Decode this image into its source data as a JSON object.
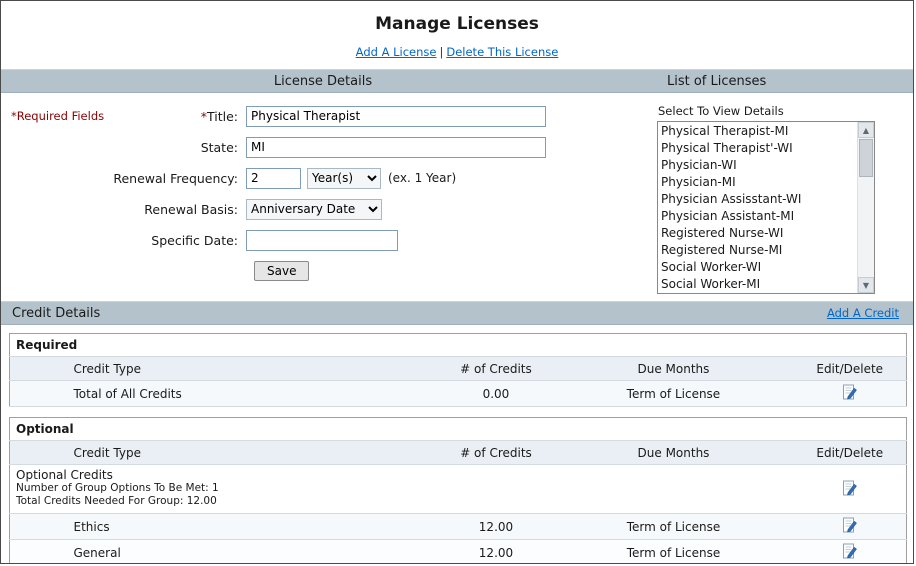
{
  "page": {
    "title": "Manage Licenses"
  },
  "top_links": {
    "add_license": "Add A License",
    "separator": "|",
    "delete_license": "Delete This License"
  },
  "colors": {
    "header_bar": "#b4c2cc",
    "link": "#0066cc",
    "required_red": "#8b0000",
    "table_header_row": "#e9eff4"
  },
  "license_details": {
    "header": "License Details",
    "required_note": "*Required Fields",
    "fields": {
      "title": {
        "star": "*",
        "label": "Title:",
        "value": "Physical Therapist"
      },
      "state": {
        "label": "State:",
        "value": "MI"
      },
      "renewal_frequency": {
        "label": "Renewal Frequency:",
        "value": "2",
        "unit": "Year(s)",
        "hint": "(ex. 1 Year)"
      },
      "renewal_basis": {
        "label": "Renewal Basis:",
        "value": "Anniversary Date"
      },
      "specific_date": {
        "label": "Specific Date:",
        "value": ""
      }
    },
    "save_label": "Save"
  },
  "list_of_licenses": {
    "header": "List of Licenses",
    "select_hint": "Select To View Details",
    "items": [
      "Physical Therapist-MI",
      "Physical Therapist'-WI",
      "Physician-WI",
      "Physician-MI",
      "Physician Assisstant-WI",
      "Physician Assistant-MI",
      "Registered Nurse-WI",
      "Registered Nurse-MI",
      "Social Worker-WI",
      "Social Worker-MI"
    ]
  },
  "credit_details": {
    "header": "Credit Details",
    "add_credit_link": "Add A Credit",
    "required": {
      "title": "Required",
      "columns": [
        "Credit Type",
        "# of Credits",
        "Due Months",
        "Edit/Delete"
      ],
      "rows": [
        {
          "credit_type": "Total of All Credits",
          "credits": "0.00",
          "due": "Term of License"
        }
      ]
    },
    "optional": {
      "title": "Optional",
      "columns": [
        "Credit Type",
        "# of Credits",
        "Due Months",
        "Edit/Delete"
      ],
      "group": {
        "name": "Optional Credits",
        "line2": "Number of Group Options To Be Met: 1",
        "line3": "Total Credits Needed For Group: 12.00"
      },
      "rows": [
        {
          "credit_type": "Ethics",
          "credits": "12.00",
          "due": "Term of License"
        },
        {
          "credit_type": "General",
          "credits": "12.00",
          "due": "Term of License"
        }
      ]
    }
  }
}
